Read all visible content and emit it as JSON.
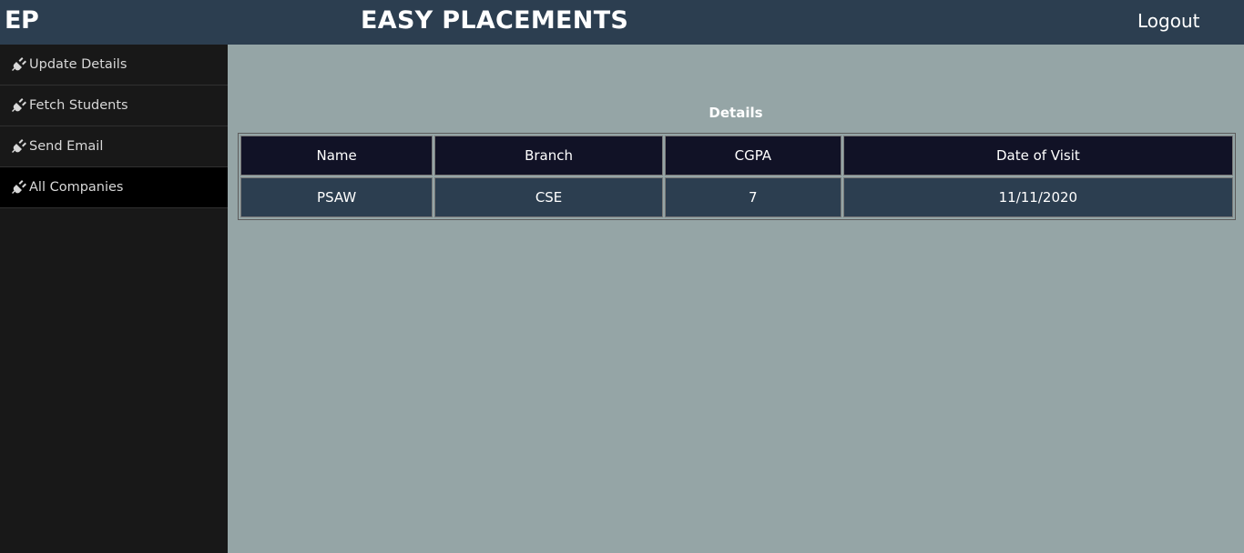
{
  "header": {
    "brand": "EP",
    "title": "EASY PLACEMENTS",
    "logout_label": "Logout"
  },
  "sidebar": {
    "items": [
      {
        "label": "Update Details",
        "icon": "plug-icon",
        "active": false
      },
      {
        "label": "Fetch Students",
        "icon": "plug-icon",
        "active": false
      },
      {
        "label": "Send Email",
        "icon": "plug-icon",
        "active": false
      },
      {
        "label": "All Companies",
        "icon": "plug-icon",
        "active": true
      }
    ]
  },
  "main": {
    "caption": "Details",
    "table": {
      "headers": [
        "Name",
        "Branch",
        "CGPA",
        "Date of Visit"
      ],
      "rows": [
        [
          "PSAW",
          "CSE",
          "7",
          "11/11/2020"
        ]
      ]
    }
  },
  "colors": {
    "topbar": "#2c3e50",
    "sidebar": "#181818",
    "main_bg": "#95a5a6",
    "table_header": "#111226",
    "table_row": "#2c3e50"
  }
}
